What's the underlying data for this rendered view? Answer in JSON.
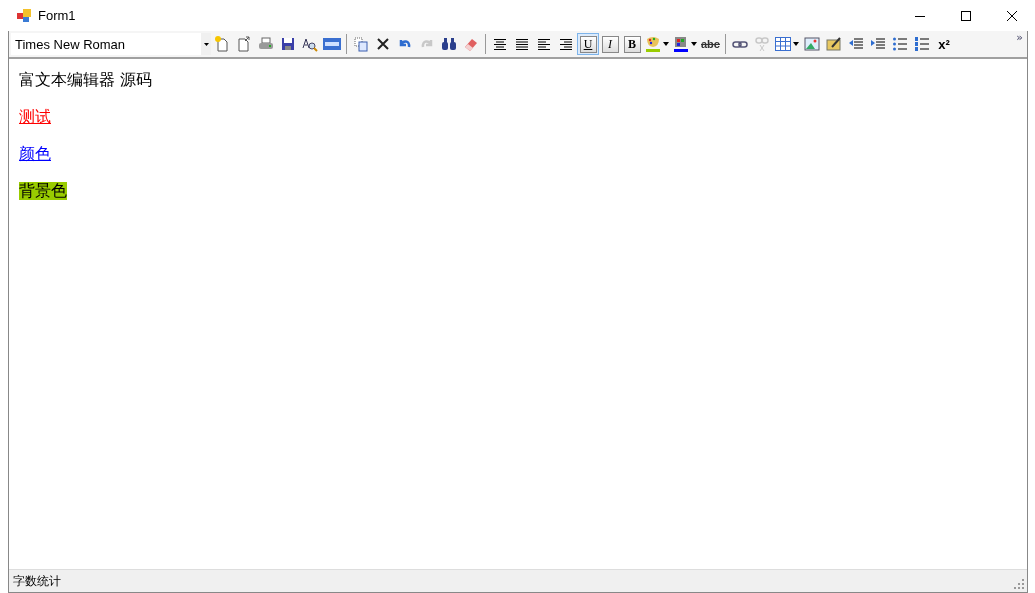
{
  "window": {
    "title": "Form1"
  },
  "toolbar": {
    "font": "Times New Roman",
    "overflow": "»",
    "tools": [
      {
        "kind": "new",
        "pressed": false,
        "disabled": false
      },
      {
        "kind": "open",
        "pressed": false,
        "disabled": false
      },
      {
        "kind": "print",
        "pressed": false,
        "disabled": false
      },
      {
        "kind": "save",
        "pressed": false,
        "disabled": false
      },
      {
        "kind": "preview",
        "pressed": false,
        "disabled": false
      },
      {
        "kind": "html",
        "pressed": false,
        "disabled": false
      },
      {
        "kind": "separator"
      },
      {
        "kind": "copy",
        "pressed": false,
        "disabled": false
      },
      {
        "kind": "delete",
        "pressed": false,
        "disabled": false
      },
      {
        "kind": "undo",
        "pressed": false,
        "disabled": false
      },
      {
        "kind": "redo",
        "pressed": false,
        "disabled": true
      },
      {
        "kind": "find",
        "pressed": false,
        "disabled": false
      },
      {
        "kind": "eraser",
        "pressed": false,
        "disabled": false
      },
      {
        "kind": "separator"
      },
      {
        "kind": "center",
        "pressed": false,
        "disabled": false
      },
      {
        "kind": "justify",
        "pressed": false,
        "disabled": false
      },
      {
        "kind": "left",
        "pressed": false,
        "disabled": false
      },
      {
        "kind": "right",
        "pressed": false,
        "disabled": false
      },
      {
        "kind": "underline",
        "label": "U",
        "pressed": true,
        "disabled": false
      },
      {
        "kind": "italic",
        "label": "I",
        "pressed": false,
        "disabled": false
      },
      {
        "kind": "bold",
        "label": "B",
        "pressed": false,
        "disabled": false
      },
      {
        "kind": "highlight",
        "color": "#99cc00",
        "pressed": false,
        "disabled": false
      },
      {
        "kind": "fontcolor",
        "color": "#0000ff",
        "pressed": false,
        "disabled": false
      },
      {
        "kind": "strike",
        "label": "abc",
        "pressed": false,
        "disabled": false
      },
      {
        "kind": "separator"
      },
      {
        "kind": "link",
        "pressed": false,
        "disabled": false
      },
      {
        "kind": "unlink",
        "pressed": false,
        "disabled": true
      },
      {
        "kind": "table",
        "pressed": false,
        "disabled": false
      },
      {
        "kind": "image",
        "pressed": false,
        "disabled": false
      },
      {
        "kind": "edit",
        "pressed": false,
        "disabled": false
      },
      {
        "kind": "outdent",
        "pressed": false,
        "disabled": false
      },
      {
        "kind": "indent",
        "pressed": false,
        "disabled": false
      },
      {
        "kind": "bullets",
        "pressed": false,
        "disabled": false
      },
      {
        "kind": "numbers",
        "pressed": false,
        "disabled": false
      },
      {
        "kind": "superscript",
        "label": "x²",
        "pressed": false,
        "disabled": false
      }
    ]
  },
  "editor": {
    "paragraphs": [
      {
        "text": "富文本编辑器 源码",
        "color": "#000000",
        "underline": false
      },
      {
        "text": "测试",
        "color": "#ff0000",
        "underline": true
      },
      {
        "text": "颜色",
        "color": "#0000ff",
        "underline": true
      },
      {
        "text": "背景色",
        "underline": false,
        "highlight": {
          "color": "#99cc00"
        }
      }
    ]
  },
  "status_bar": {
    "text": "字数统计"
  }
}
